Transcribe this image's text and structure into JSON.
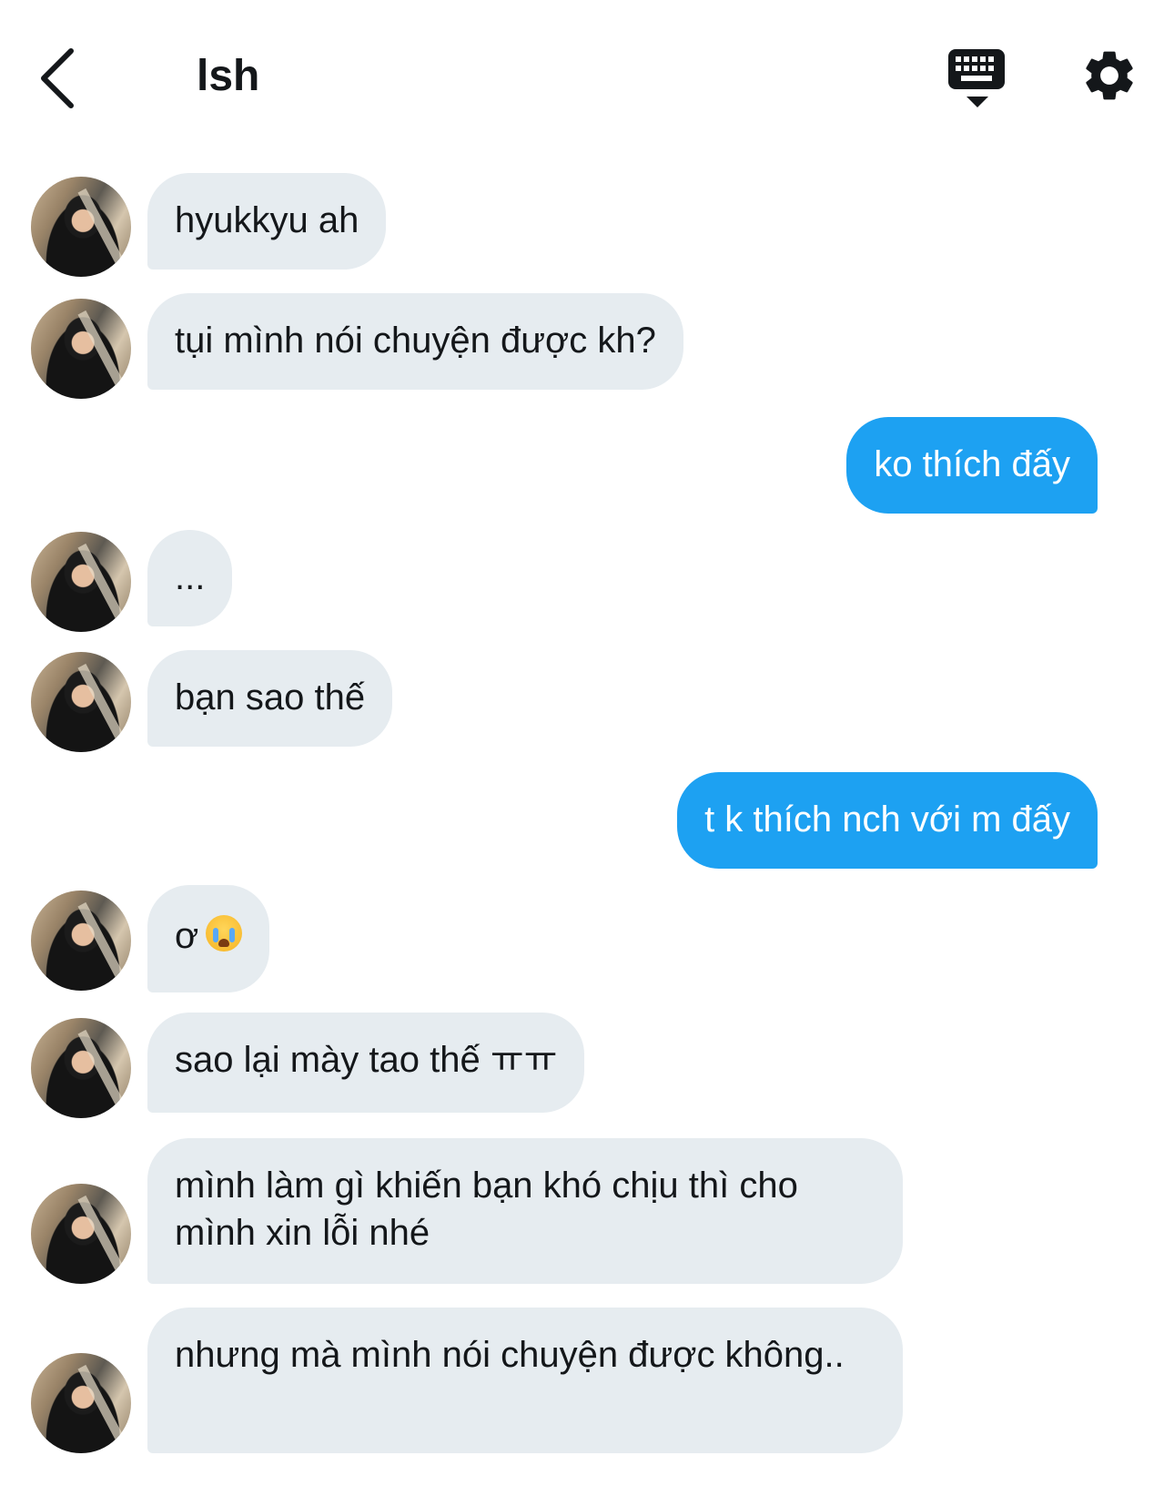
{
  "header": {
    "title": "lsh",
    "back_icon": "chevron-left-icon",
    "keyboard_icon": "keyboard-icon",
    "settings_icon": "gear-icon"
  },
  "colors": {
    "incoming_bubble": "#e6ecf0",
    "outgoing_bubble": "#1da1f2",
    "text": "#14171a"
  },
  "messages": [
    {
      "direction": "in",
      "text": "hyukkyu ah"
    },
    {
      "direction": "in",
      "text": "tụi mình nói chuyện được kh?"
    },
    {
      "direction": "out",
      "text": "ko thích đấy"
    },
    {
      "direction": "in",
      "text": "..."
    },
    {
      "direction": "in",
      "text": "bạn sao thế"
    },
    {
      "direction": "out",
      "text": "t k thích nch với m đấy"
    },
    {
      "direction": "in",
      "text": "ơ",
      "emoji": "crying-face-emoji"
    },
    {
      "direction": "in",
      "text": "sao lại mày tao thế ㅠㅠ"
    },
    {
      "direction": "in",
      "text": "mình làm gì khiến bạn khó chịu thì cho mình xin lỗi nhé"
    },
    {
      "direction": "in",
      "text": "nhưng mà mình nói chuyện được không.."
    }
  ]
}
